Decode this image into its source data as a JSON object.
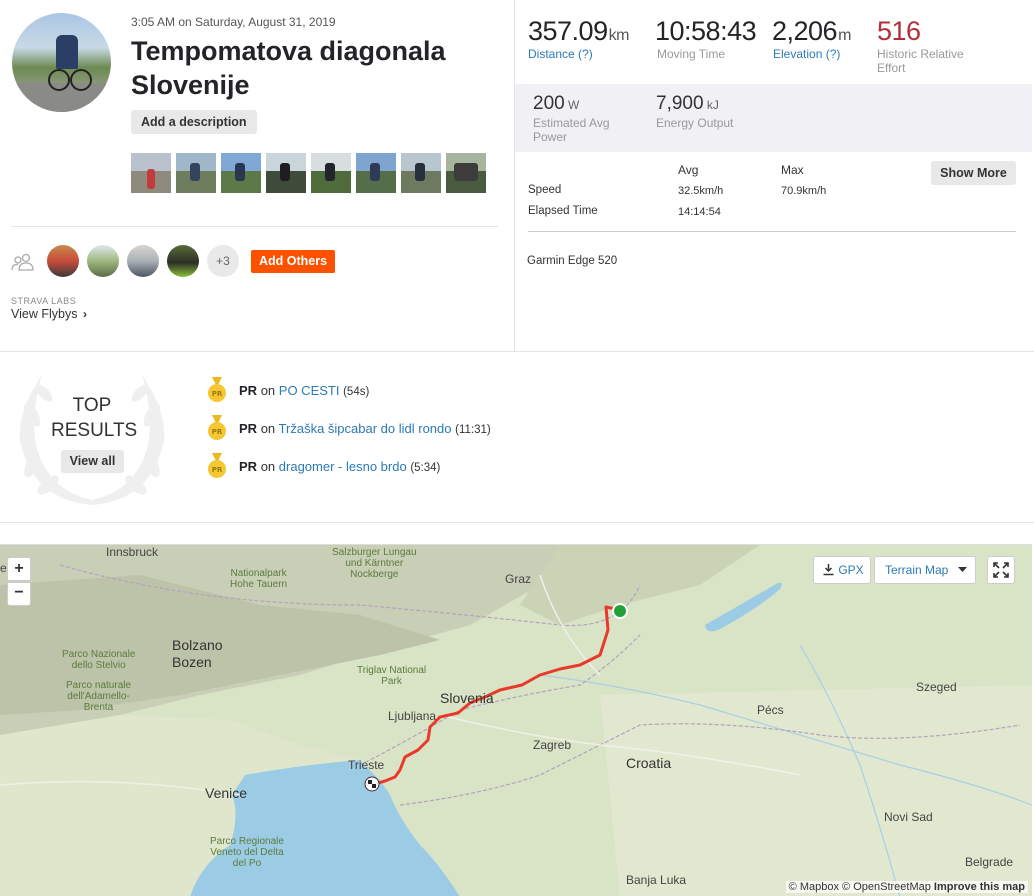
{
  "activity": {
    "date": "3:05 AM on Saturday, August 31, 2019",
    "title": "Tempomatova diagonala Slovenije",
    "add_description": "Add a description"
  },
  "kudos": {
    "more_count": "+3",
    "add_others": "Add Others"
  },
  "labs": {
    "label": "STRAVA LABS",
    "flybys": "View Flybys"
  },
  "stats": {
    "distance": {
      "value": "357.09",
      "unit": "km",
      "label": "Distance (?)"
    },
    "moving_time": {
      "value": "10:58:43",
      "label": "Moving Time"
    },
    "elevation": {
      "value": "2,206",
      "unit": "m",
      "label": "Elevation (?)"
    },
    "effort": {
      "value": "516",
      "label": "Historic Relative Effort"
    },
    "power": {
      "value": "200",
      "unit": "W",
      "label": "Estimated Avg Power"
    },
    "energy": {
      "value": "7,900",
      "unit": "kJ",
      "label": "Energy Output"
    }
  },
  "table": {
    "headers": {
      "avg": "Avg",
      "max": "Max"
    },
    "rows": [
      {
        "label": "Speed",
        "avg": "32.5km/h",
        "max": "70.9km/h"
      },
      {
        "label": "Elapsed Time",
        "avg": "14:14:54",
        "max": ""
      }
    ],
    "show_more": "Show More",
    "device": "Garmin Edge 520"
  },
  "top_results": {
    "title_line1": "TOP",
    "title_line2": "RESULTS",
    "view_all": "View all",
    "medal_text": "PR",
    "prs": [
      {
        "badge": "PR",
        "on": "on",
        "segment": "PO CESTI",
        "time": "(54s)"
      },
      {
        "badge": "PR",
        "on": "on",
        "segment": "Tržaška šipcabar do lidl rondo",
        "time": "(11:31)"
      },
      {
        "badge": "PR",
        "on": "on",
        "segment": "dragomer - lesno brdo",
        "time": "(5:34)"
      }
    ]
  },
  "map": {
    "zoom_in": "+",
    "zoom_out": "−",
    "gpx": "GPX",
    "terrain": "Terrain Map",
    "attribution_mapbox": "© Mapbox",
    "attribution_osm": "© OpenStreetMap",
    "attribution_improve": "Improve this map",
    "labels": {
      "innsbruck": "Innsbruck",
      "ein": "ein",
      "salzburger": "Salzburger Lungau\nund Kärntner\nNockberge",
      "hohe_tauern": "Nationalpark\nHohe Tauern",
      "graz": "Graz",
      "bolzano": "Bolzano\nBozen",
      "stelvio": "Parco Nazionale\ndello Stelvio",
      "adamello": "Parco naturale\ndell'Adamello-\nBrenta",
      "triglav": "Triglav National\nPark",
      "slovenia": "Slovenia",
      "ljubljana": "Ljubljana",
      "zagreb": "Zagreb",
      "pecs": "Pécs",
      "szeged": "Szeged",
      "croatia": "Croatia",
      "trieste": "Trieste",
      "venice": "Venice",
      "delta_po": "Parco Regionale\nVeneto del Delta\ndel Po",
      "novi_sad": "Novi Sad",
      "banja_luka": "Banja Luka",
      "belgrade": "Belgrade"
    }
  },
  "colors": {
    "brand": "#fc5200",
    "link": "#2c7ab6",
    "effort": "#b32e3a",
    "route": "#e8392b",
    "start": "#22a13a"
  }
}
